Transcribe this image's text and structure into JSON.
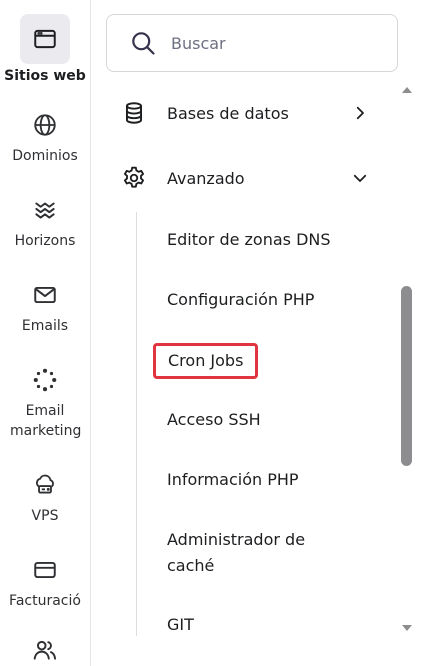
{
  "rail": {
    "items": [
      {
        "label": "Sitios web",
        "icon": "browser-window-icon",
        "active": true
      },
      {
        "label": "Dominios",
        "icon": "globe-icon"
      },
      {
        "label": "Horizons",
        "icon": "horizons-icon"
      },
      {
        "label": "Emails",
        "icon": "mail-icon"
      },
      {
        "label": "Email marketing",
        "icon": "spinner-dots-icon"
      },
      {
        "label": "VPS",
        "icon": "cloud-server-icon"
      },
      {
        "label": "Facturació",
        "icon": "credit-card-icon"
      },
      {
        "label": "",
        "icon": "users-icon"
      }
    ]
  },
  "search": {
    "placeholder": "Buscar"
  },
  "menu": {
    "databases_label": "Bases de datos",
    "advanced_label": "Avanzado"
  },
  "advanced_items": [
    {
      "label": "Editor de zonas DNS"
    },
    {
      "label": "Configuración PHP"
    },
    {
      "label": "Cron Jobs",
      "highlighted": true
    },
    {
      "label": "Acceso SSH"
    },
    {
      "label": "Información PHP"
    },
    {
      "label": "Administrador de caché"
    },
    {
      "label": "GIT"
    }
  ],
  "colors": {
    "highlight_border": "#e0353f",
    "active_bg": "#ebebef",
    "scroll_thumb": "#8d8d8f"
  }
}
